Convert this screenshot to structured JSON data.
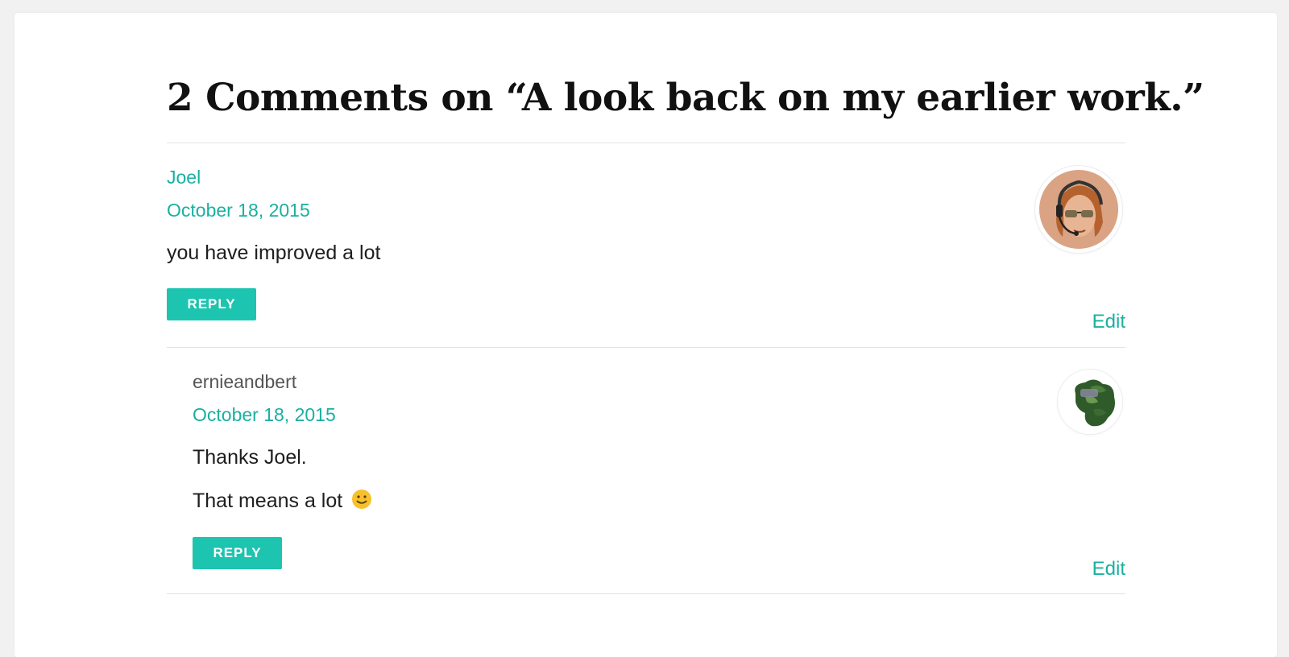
{
  "heading": "2 Comments on “A look back on my earlier work.”",
  "comments": [
    {
      "author": "Joel",
      "date": "October 18, 2015",
      "body": [
        "you have improved a lot"
      ],
      "reply_label": "REPLY",
      "edit_label": "Edit",
      "avatar_icon": "avatar-headset-sunglasses-icon"
    },
    {
      "author": "ernieandbert",
      "date": "October 18, 2015",
      "body": [
        "Thanks Joel.",
        "That means a lot"
      ],
      "emoji_icon": "slight-smile-emoji-icon",
      "reply_label": "REPLY",
      "edit_label": "Edit",
      "avatar_icon": "avatar-tree-photo-icon"
    }
  ],
  "colors": {
    "accent": "#19b0a0",
    "button": "#1dc4af",
    "text": "#1e1e1e",
    "heading": "#111111"
  }
}
